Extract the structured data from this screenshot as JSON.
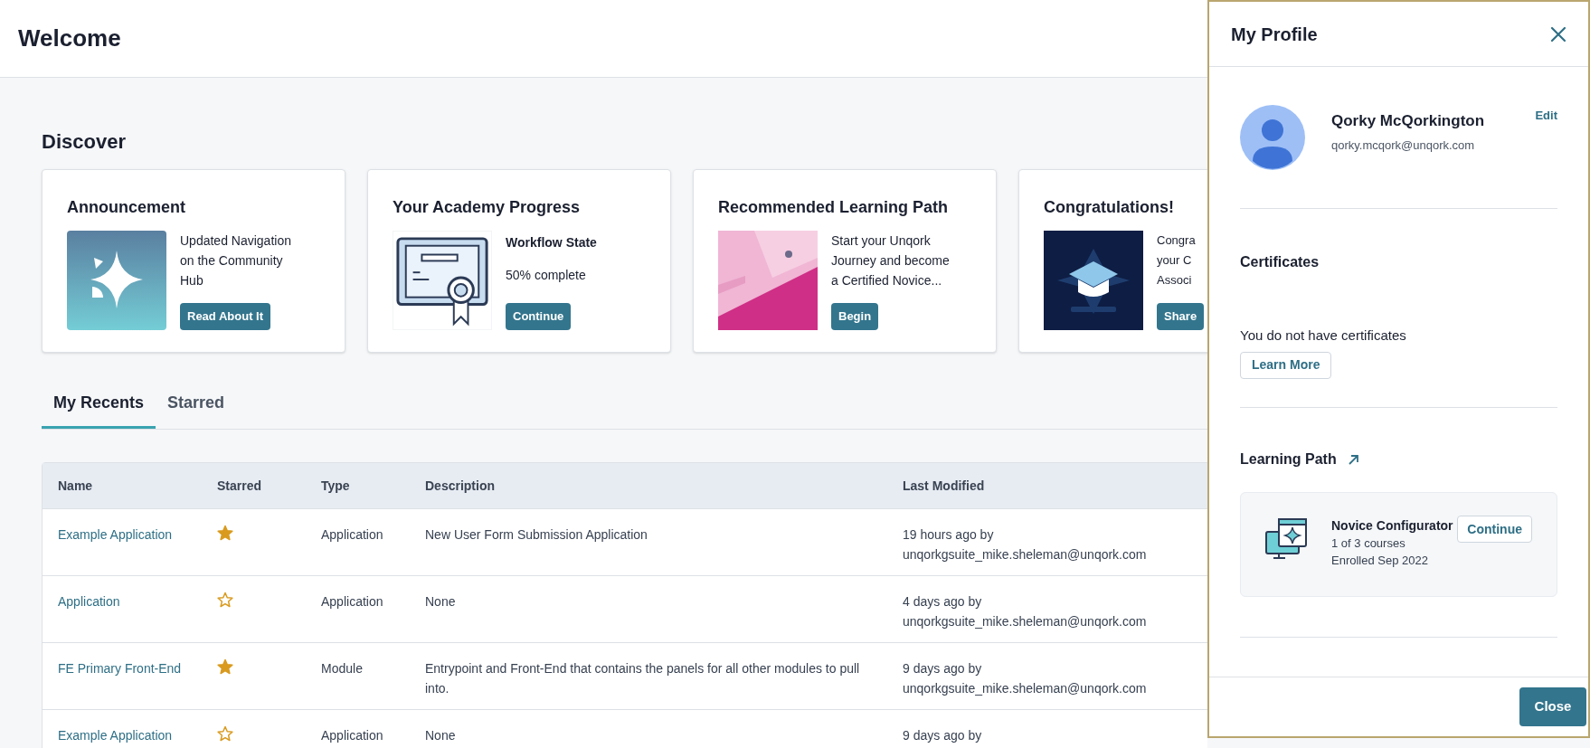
{
  "header": {
    "title": "Welcome"
  },
  "discover": {
    "title": "Discover",
    "cards": [
      {
        "title": "Announcement",
        "kind": "sparkle",
        "text": "Updated Navigation on the Community Hub",
        "button": "Read About It"
      },
      {
        "title": "Your Academy Progress",
        "kind": "certificate",
        "heading": "Workflow State",
        "text": "50% complete",
        "button": "Continue"
      },
      {
        "title": "Recommended Learning Path",
        "kind": "picture",
        "text": "Start your Unqork Journey and become a Certified Novice...",
        "button": "Begin"
      },
      {
        "title": "Congratulations!",
        "kind": "badge",
        "lines": [
          "Congra",
          "your C",
          "Associ"
        ],
        "button": "Share"
      }
    ]
  },
  "tabs": [
    {
      "label": "My Recents",
      "selected": true
    },
    {
      "label": "Starred",
      "selected": false
    }
  ],
  "table": {
    "columns": [
      "Name",
      "Starred",
      "Type",
      "Description",
      "Last Modified"
    ],
    "rows": [
      {
        "name": "Example Application",
        "starred": true,
        "type": "Application",
        "description": "New User Form Submission Application",
        "modified": [
          "19 hours ago by",
          "unqorkgsuite_mike.sheleman@unqork.com"
        ]
      },
      {
        "name": "Application",
        "starred": false,
        "type": "Application",
        "description": "None",
        "modified": [
          "4 days ago by",
          "unqorkgsuite_mike.sheleman@unqork.com"
        ]
      },
      {
        "name": "FE Primary Front-End",
        "starred": true,
        "type": "Module",
        "description": "Entrypoint and Front-End that contains the panels for all other modules to pull into.",
        "modified": [
          "9 days ago by",
          "unqorkgsuite_mike.sheleman@unqork.com"
        ]
      },
      {
        "name": "Example Application",
        "starred": false,
        "type": "Application",
        "description": "None",
        "modified": [
          "9 days ago by"
        ]
      }
    ]
  },
  "profile": {
    "title": "My Profile",
    "name": "Qorky McQorkington",
    "email": "qorky.mcqork@unqork.com",
    "edit": "Edit",
    "certificates": {
      "title": "Certificates",
      "message": "You do not have certificates",
      "button": "Learn More"
    },
    "learning_path": {
      "title": "Learning Path",
      "course": {
        "name": "Novice Configurator",
        "progress": "1 of 3 courses",
        "enrolled": "Enrolled Sep 2022",
        "button": "Continue"
      }
    },
    "footer_button": "Close"
  }
}
